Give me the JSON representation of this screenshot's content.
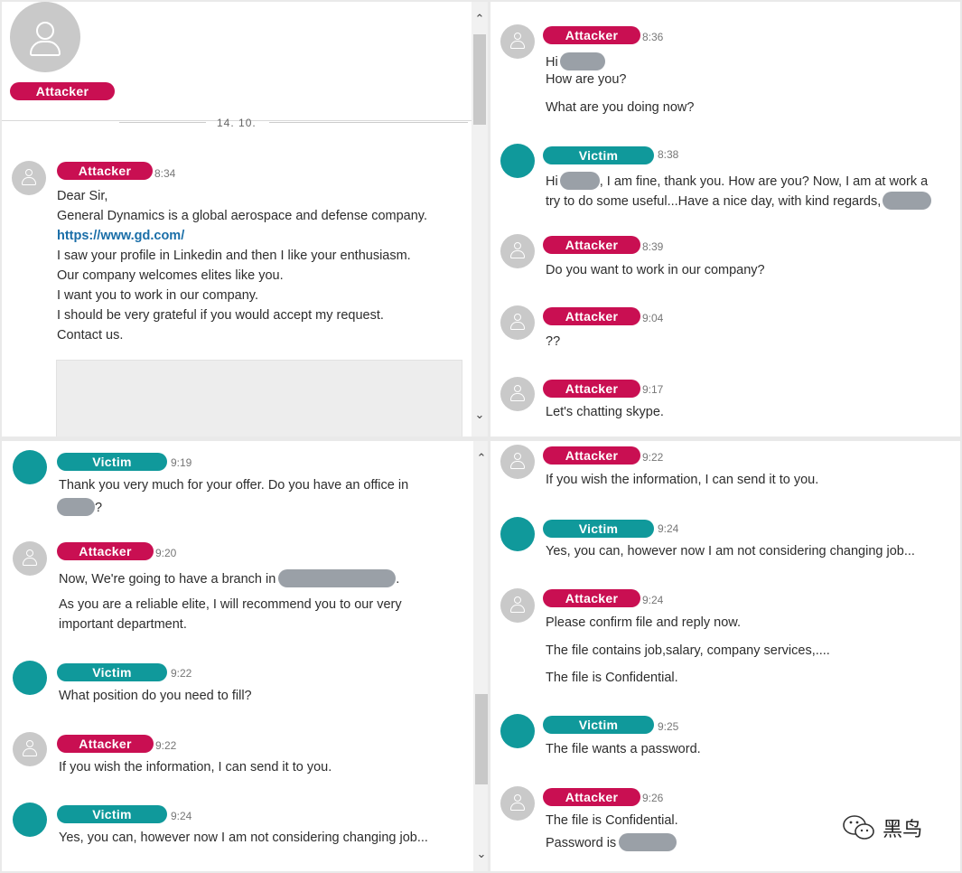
{
  "profile": {
    "name": "Attacker",
    "date_separator": "14. 10."
  },
  "panel1": [
    {
      "sender": "Attacker",
      "time": "8:34",
      "lines": [
        "Dear Sir,",
        "General Dynamics is a global aerospace and defense company.",
        "https://www.gd.com/",
        "I saw your profile in Linkedin and then I like your enthusiasm.",
        "Our company welcomes elites like you.",
        "I want you to work in our company.",
        "I should be very grateful if you would accept my request.",
        "Contact us."
      ]
    }
  ],
  "panel2": [
    {
      "sender": "Attacker",
      "time": "8:36",
      "lines": [
        "Hi",
        "How are you?",
        "What are you doing now?"
      ]
    },
    {
      "sender": "Victim",
      "time": "8:38",
      "lines": [
        "Hi",
        ", I am fine, thank you. How are you? Now, I am at work a",
        "try to do some useful...Have a nice day, with kind regards,"
      ]
    },
    {
      "sender": "Attacker",
      "time": "8:39",
      "lines": [
        "Do you want to work in our company?"
      ]
    },
    {
      "sender": "Attacker",
      "time": "9:04",
      "lines": [
        "??"
      ]
    },
    {
      "sender": "Attacker",
      "time": "9:17",
      "lines": [
        "Let's chatting skype."
      ]
    }
  ],
  "panel3": [
    {
      "sender": "Victim",
      "time": "9:19",
      "lines": [
        "Thank you very much for your offer. Do you have an office in",
        "?"
      ]
    },
    {
      "sender": "Attacker",
      "time": "9:20",
      "lines": [
        "Now, We're going to have a branch in",
        ".",
        "As you are a reliable elite, I will recommend you to our very",
        "important department."
      ]
    },
    {
      "sender": "Victim",
      "time": "9:22",
      "lines": [
        "What position do you need to fill?"
      ]
    },
    {
      "sender": "Attacker",
      "time": "9:22",
      "lines": [
        "If you wish the information, I can send it to you."
      ]
    },
    {
      "sender": "Victim",
      "time": "9:24",
      "lines": [
        "Yes, you can, however now I am not considering changing job..."
      ]
    }
  ],
  "panel4": [
    {
      "sender": "Attacker",
      "time": "9:22",
      "lines": [
        "If you wish the information, I can send it to you."
      ]
    },
    {
      "sender": "Victim",
      "time": "9:24",
      "lines": [
        "Yes, you can, however now I am not considering changing job..."
      ]
    },
    {
      "sender": "Attacker",
      "time": "9:24",
      "lines": [
        "Please confirm file and reply now.",
        "The file contains job,salary, company services,....",
        "The file is Confidential."
      ]
    },
    {
      "sender": "Victim",
      "time": "9:25",
      "lines": [
        "The file wants a password."
      ]
    },
    {
      "sender": "Attacker",
      "time": "9:26",
      "lines": [
        "The file is Confidential.",
        "Password is"
      ]
    }
  ],
  "watermark": "黑鸟",
  "colors": {
    "attacker": "#c90f52",
    "victim": "#10999b",
    "avatar_grey": "#c9c9c9",
    "redaction": "#9aa0a7"
  },
  "icons": {
    "avatar": "person-silhouette-icon",
    "scroll_up": "chevron-up-icon",
    "scroll_down": "chevron-down-icon",
    "watermark": "wechat-icon"
  }
}
